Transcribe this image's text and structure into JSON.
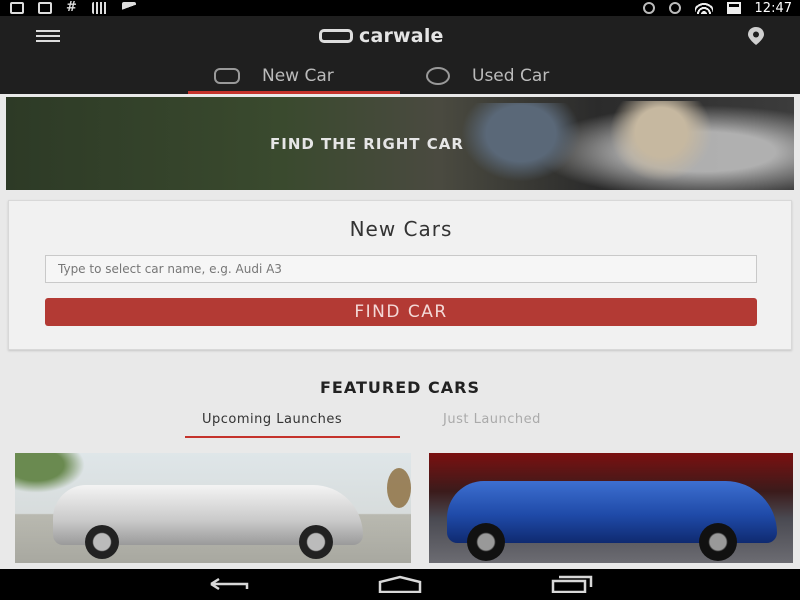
{
  "status_bar": {
    "time": "12:47",
    "left_icons": [
      "download-icon",
      "message-icon",
      "hash-icon",
      "signal-bars-icon",
      "flag-icon"
    ],
    "right_icons": [
      "bluetooth-icon",
      "mute-icon",
      "wifi-icon",
      "battery-icon"
    ]
  },
  "app_bar": {
    "brand": "carwale",
    "menu_icon": "hamburger-icon",
    "location_icon": "location-pin-icon",
    "tabs": [
      {
        "label": "New Car",
        "icon": "new-car-tag-icon",
        "active": true
      },
      {
        "label": "Used Car",
        "icon": "used-car-icon",
        "active": false
      }
    ],
    "accent_color": "#c5332c"
  },
  "hero": {
    "headline": "FIND THE RIGHT CAR"
  },
  "new_cars": {
    "title": "New Cars",
    "search_placeholder": "Type to select car name, e.g. Audi A3",
    "button_label": "FIND CAR",
    "button_color": "#b33a34"
  },
  "featured": {
    "title": "FEATURED CARS",
    "tabs": [
      {
        "label": "Upcoming Launches",
        "active": true
      },
      {
        "label": "Just Launched",
        "active": false
      }
    ],
    "cards": [
      {
        "name": "car-image-silver-sedan"
      },
      {
        "name": "car-image-blue-suv"
      }
    ]
  },
  "nav_bar": {
    "buttons": [
      "back-icon",
      "home-icon",
      "recents-icon"
    ]
  }
}
